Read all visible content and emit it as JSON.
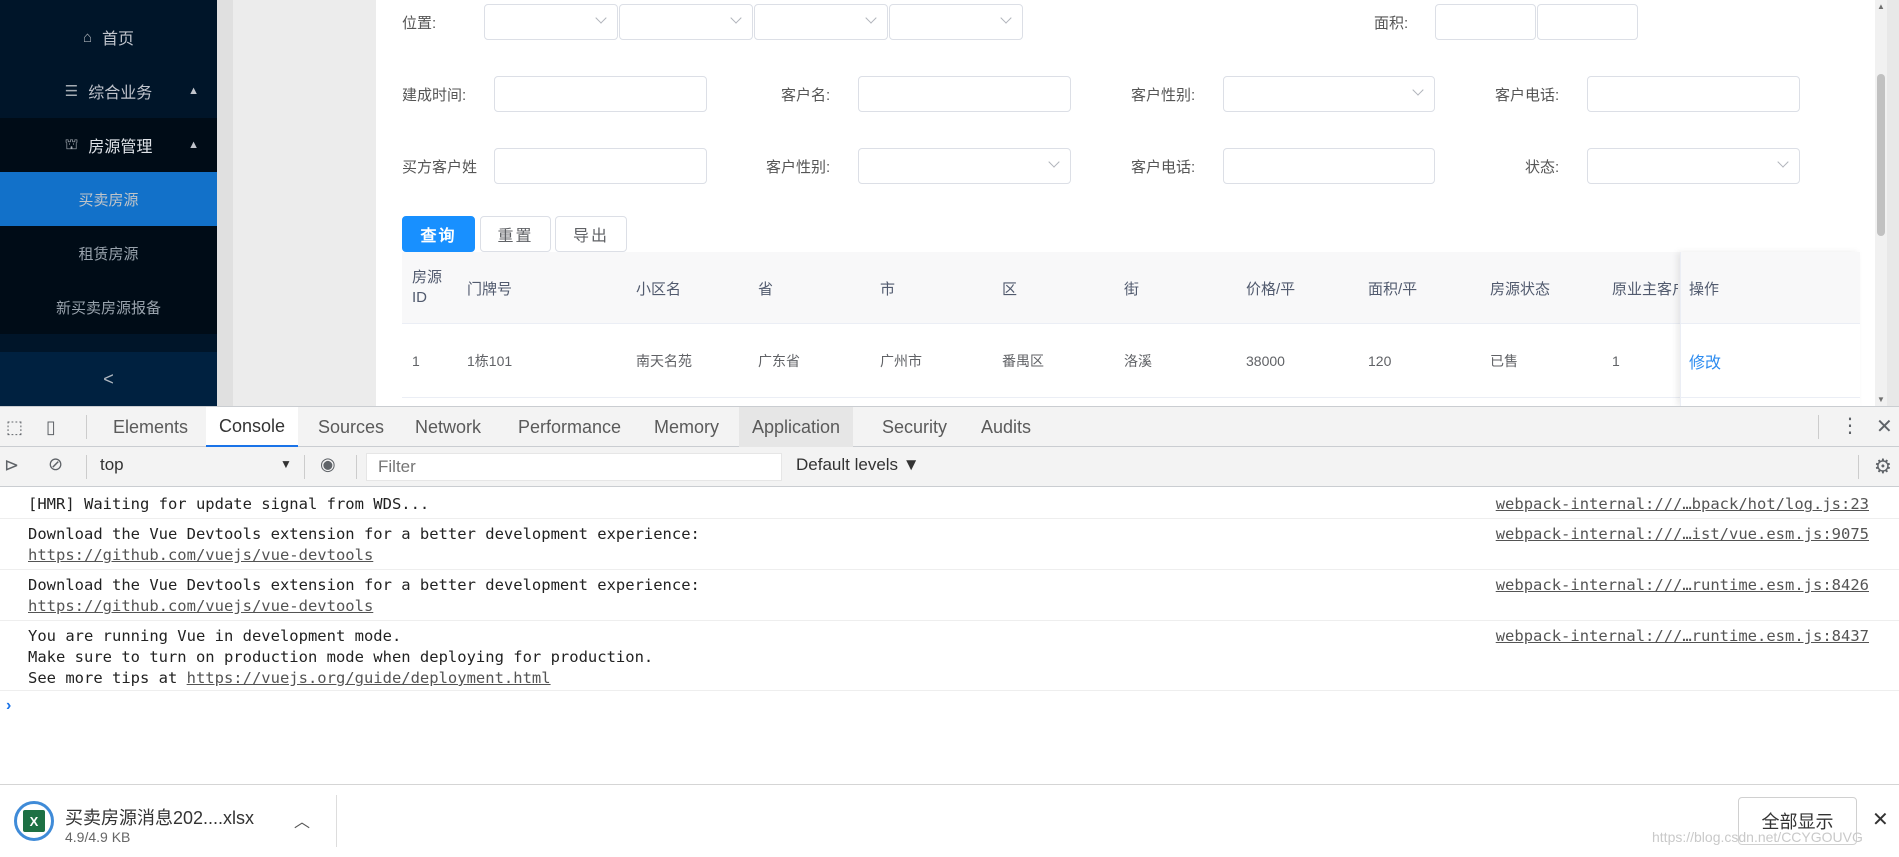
{
  "sidebar": {
    "home": "首页",
    "business": "综合业务",
    "house_mgmt": "房源管理",
    "sub_items": [
      "买卖房源",
      "租赁房源",
      "新买卖房源报备"
    ],
    "collapse": "<"
  },
  "filters": {
    "location_label": "位置:",
    "area_label": "面积:",
    "build_time_label": "建成时间:",
    "customer_name_label": "客户名:",
    "customer_gender_label": "客户性别:",
    "customer_phone_label": "客户电话:",
    "buyer_surname_label": "买方客户姓",
    "buyer_gender_label": "客户性别:",
    "buyer_phone_label": "客户电话:",
    "status_label": "状态:"
  },
  "buttons": {
    "query": "查询",
    "reset": "重置",
    "export": "导出"
  },
  "table": {
    "headers": [
      "房源ID",
      "门牌号",
      "小区名",
      "省",
      "市",
      "区",
      "街",
      "价格/平",
      "面积/平",
      "房源状态",
      "原业主客户",
      "操作"
    ],
    "header_first_line1": "房源",
    "header_first_line2": "ID",
    "row": [
      "1",
      "1栋101",
      "南天名苑",
      "广东省",
      "广州市",
      "番禺区",
      "洛溪",
      "38000",
      "120",
      "已售",
      "1"
    ],
    "action": "修改"
  },
  "devtools": {
    "tabs": [
      "Elements",
      "Console",
      "Sources",
      "Network",
      "Performance",
      "Memory",
      "Application",
      "Security",
      "Audits"
    ],
    "active_tab": "Console",
    "context": "top",
    "filter_placeholder": "Filter",
    "levels": "Default levels ▼",
    "logs": [
      {
        "msg": "[HMR] Waiting for update signal from WDS...",
        "src": "webpack-internal:///…bpack/hot/log.js:23"
      },
      {
        "msg": "Download the Vue Devtools extension for a better development experience:",
        "link": "https://github.com/vuejs/vue-devtools",
        "src": "webpack-internal:///…ist/vue.esm.js:9075"
      },
      {
        "msg": "Download the Vue Devtools extension for a better development experience:",
        "link": "https://github.com/vuejs/vue-devtools",
        "src": "webpack-internal:///…runtime.esm.js:8426"
      },
      {
        "msg": "You are running Vue in development mode.",
        "msg2": "Make sure to turn on production mode when deploying for production.",
        "msg3_prefix": "See more tips at ",
        "link": "https://vuejs.org/guide/deployment.html",
        "src": "webpack-internal:///…runtime.esm.js:8437"
      }
    ],
    "prompt": "›"
  },
  "download": {
    "file_name": "买卖房源消息202....xlsx",
    "size": "4.9/4.9 KB",
    "show_all": "全部显示",
    "watermark": "https://blog.csdn.net/CCYGOUVG"
  }
}
